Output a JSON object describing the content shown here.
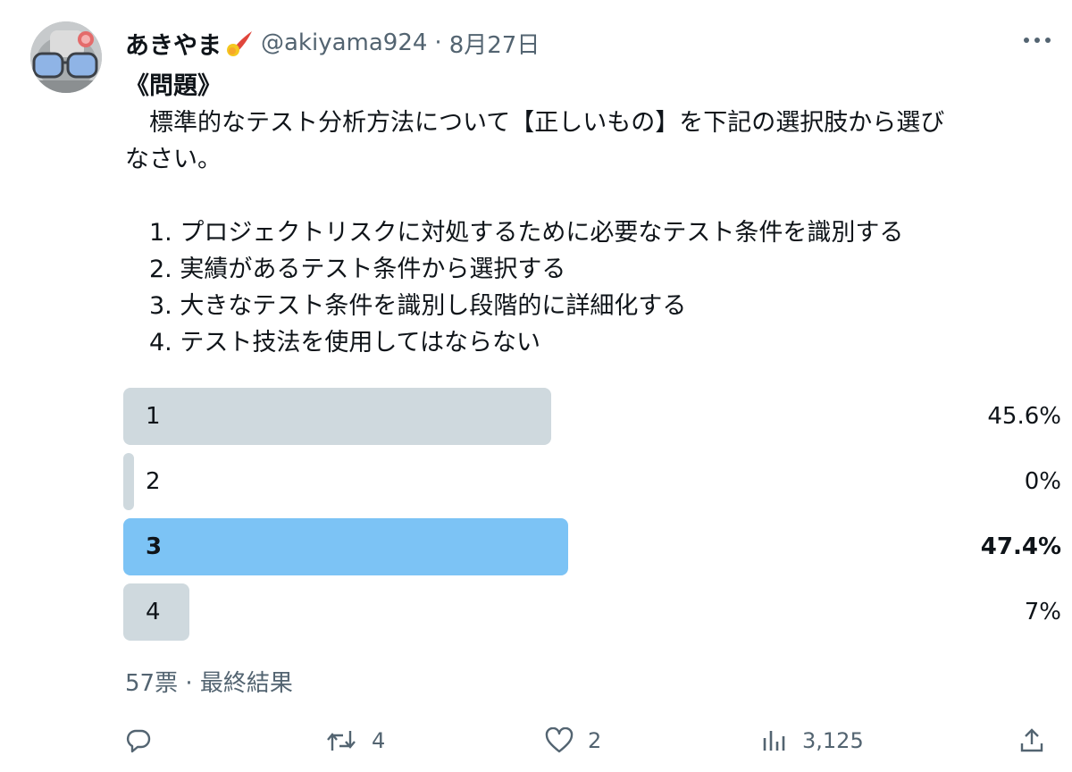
{
  "tweet": {
    "display_name": "あきやま",
    "handle": "@akiyama924",
    "separator": "·",
    "date": "8月27日",
    "body": {
      "title": "《問題》",
      "question_line1": "　標準的なテスト分析方法について【正しいもの】を下記の選択肢から選び",
      "question_line2": "なさい。",
      "options": [
        "　1. プロジェクトリスクに対処するために必要なテスト条件を識別する",
        "　2. 実績があるテスト条件から選択する",
        "　3. 大きなテスト条件を識別し段階的に詳細化する",
        "　4. テスト技法を使用してはならない"
      ]
    }
  },
  "poll": {
    "choices": [
      {
        "label": "1",
        "percent_text": "45.6%",
        "percent": 45.6,
        "winner": false
      },
      {
        "label": "2",
        "percent_text": "0%",
        "percent": 0,
        "winner": false
      },
      {
        "label": "3",
        "percent_text": "47.4%",
        "percent": 47.4,
        "winner": true
      },
      {
        "label": "4",
        "percent_text": "7%",
        "percent": 7,
        "winner": false
      }
    ],
    "votes": "57票",
    "separator": "·",
    "status": "最終結果",
    "bar_color": "#cfd9de",
    "winner_color": "#7cc3f5"
  },
  "actions": {
    "reply": {
      "icon": "reply-icon",
      "count": ""
    },
    "retweet": {
      "icon": "retweet-icon",
      "count": "4"
    },
    "like": {
      "icon": "heart-icon",
      "count": "2"
    },
    "views": {
      "icon": "views-icon",
      "count": "3,125"
    },
    "share": {
      "icon": "share-icon",
      "count": ""
    }
  },
  "colors": {
    "text": "#0f1419",
    "secondary": "#536471"
  }
}
